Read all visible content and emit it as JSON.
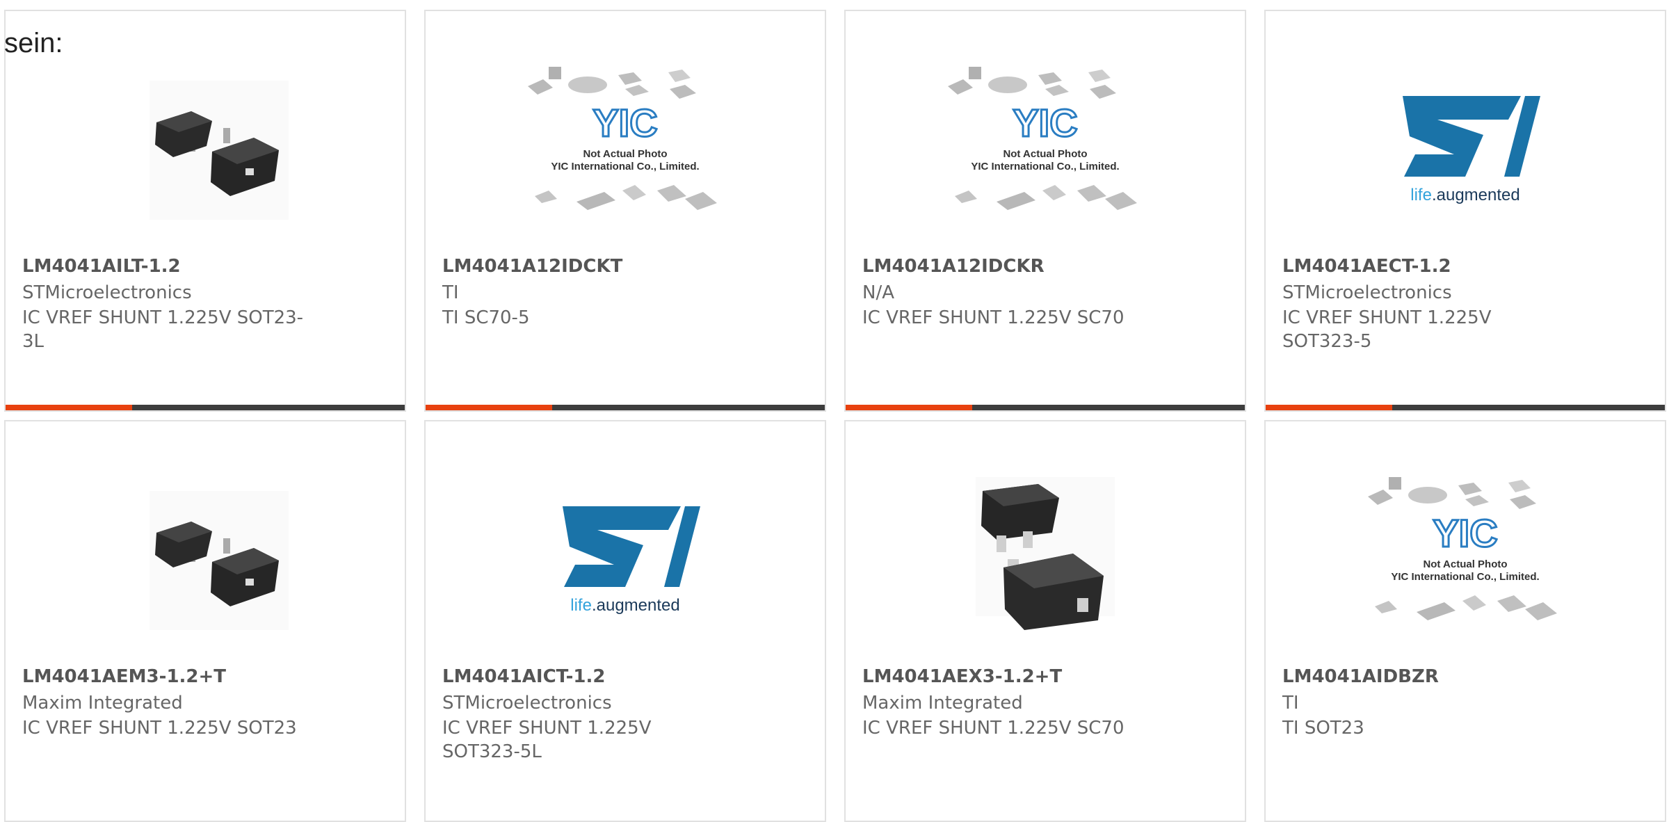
{
  "lead_text": "sein:",
  "colors": {
    "accent": "#e8410f",
    "bar_rest": "#3d3d3d",
    "st_blue": "#1a73a8"
  },
  "logos": {
    "yic_caption_1": "Not Actual Photo",
    "yic_caption_2": "YIC International Co., Limited.",
    "st_tagline_a": "life",
    "st_tagline_b": ".augmented"
  },
  "cards": [
    {
      "part": "LM4041AILT-1.2",
      "manufacturer": "STMicroelectronics",
      "description": "IC VREF SHUNT 1.225V SOT23-3L",
      "image": "sot23-chip-image"
    },
    {
      "part": "LM4041A12IDCKT",
      "manufacturer": "TI",
      "description": "TI SC70-5",
      "image": "yic-placeholder-image"
    },
    {
      "part": "LM4041A12IDCKR",
      "manufacturer": "N/A",
      "description": "IC VREF SHUNT 1.225V SC70",
      "image": "yic-placeholder-image"
    },
    {
      "part": "LM4041AECT-1.2",
      "manufacturer": "STMicroelectronics",
      "description": "IC VREF SHUNT 1.225V SOT323-5",
      "image": "st-logo-image"
    },
    {
      "part": "LM4041AEM3-1.2+T",
      "manufacturer": "Maxim Integrated",
      "description": "IC VREF SHUNT 1.225V SOT23",
      "image": "sot23-chip-image"
    },
    {
      "part": "LM4041AICT-1.2",
      "manufacturer": "STMicroelectronics",
      "description": "IC VREF SHUNT 1.225V SOT323-5L",
      "image": "st-logo-image"
    },
    {
      "part": "LM4041AEX3-1.2+T",
      "manufacturer": "Maxim Integrated",
      "description": "IC VREF SHUNT 1.225V SC70",
      "image": "sc70-chip-image"
    },
    {
      "part": "LM4041AIDBZR",
      "manufacturer": "TI",
      "description": "TI SOT23",
      "image": "yic-placeholder-image"
    }
  ]
}
